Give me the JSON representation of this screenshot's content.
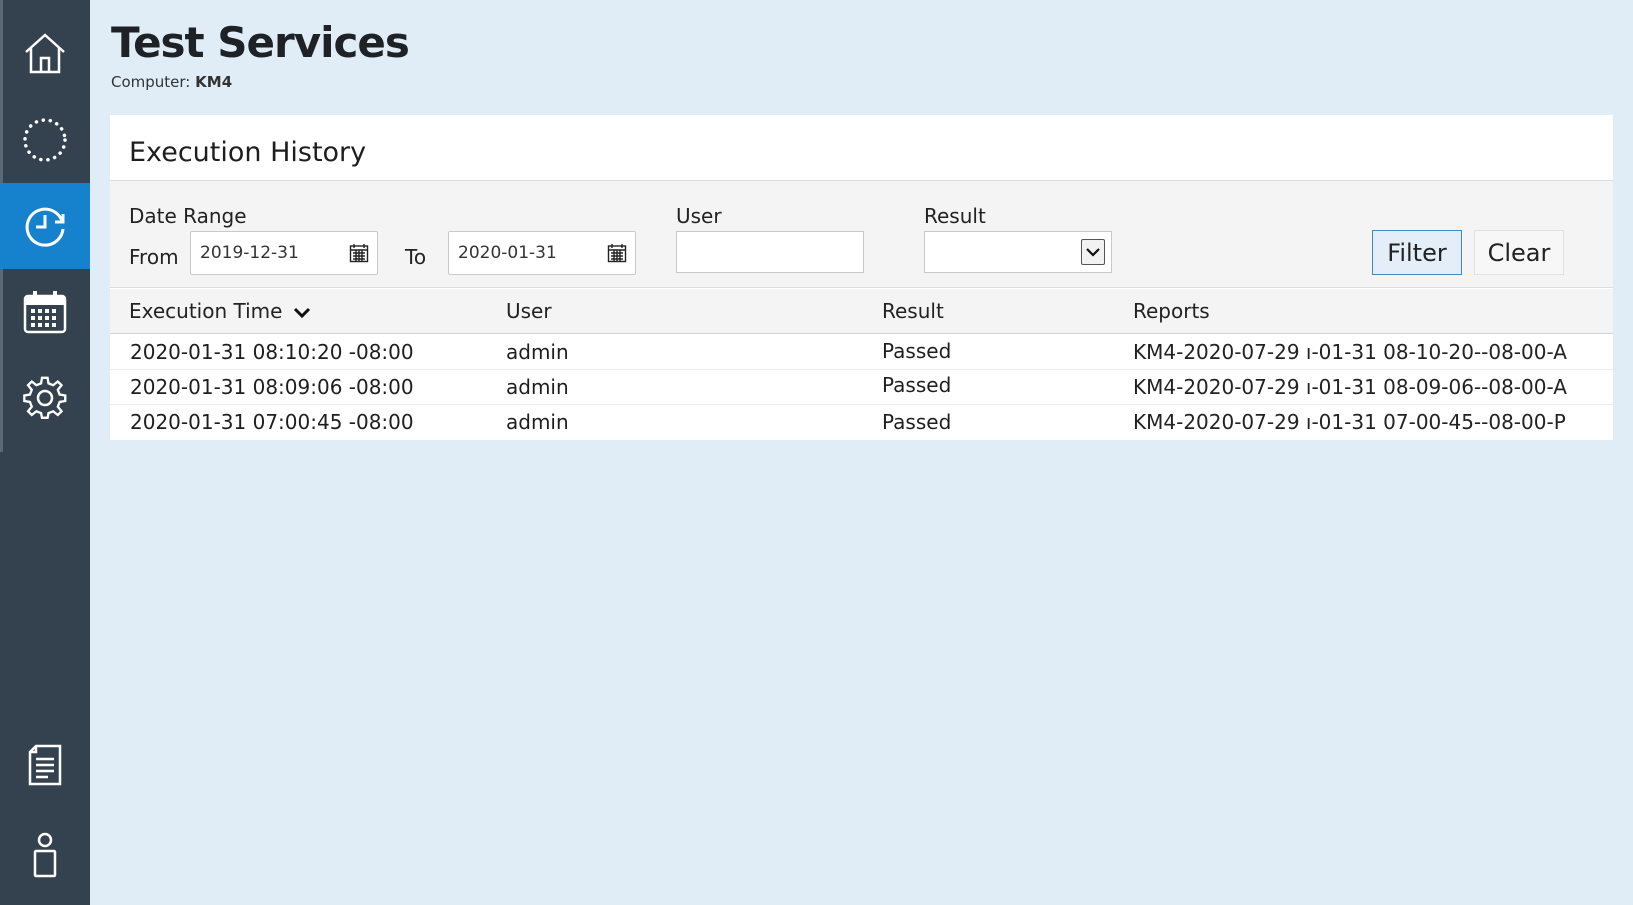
{
  "header": {
    "title": "Test Services",
    "computer_label": "Computer:",
    "computer_value": "KM4"
  },
  "sidebar": {
    "items": [
      {
        "icon": "home-icon"
      },
      {
        "icon": "dotted-circle-icon"
      },
      {
        "icon": "history-clock-icon",
        "active": true
      },
      {
        "icon": "calendar-icon"
      },
      {
        "icon": "gear-icon"
      },
      {
        "icon": "document-icon"
      },
      {
        "icon": "user-icon"
      }
    ]
  },
  "panel": {
    "title": "Execution History"
  },
  "filters": {
    "date_range_label": "Date Range",
    "from_label": "From",
    "from_value": "2019-12-31",
    "to_label": "To",
    "to_value": "2020-01-31",
    "user_label": "User",
    "user_value": "",
    "result_label": "Result",
    "result_value": "",
    "filter_button": "Filter",
    "clear_button": "Clear"
  },
  "table": {
    "columns": [
      "Execution Time",
      "User",
      "Result",
      "Reports"
    ],
    "rows": [
      {
        "time": "2020-01-31 08:10:20 -08:00",
        "user": "admin",
        "result": "Passed",
        "report": "KM4-2020-07-29 ı-01-31 08-10-20--08-00-A"
      },
      {
        "time": "2020-01-31 08:09:06 -08:00",
        "user": "admin",
        "result": "Passed",
        "report": "KM4-2020-07-29 ı-01-31 08-09-06--08-00-A"
      },
      {
        "time": "2020-01-31 07:00:45 -08:00",
        "user": "admin",
        "result": "Passed",
        "report": "KM4-2020-07-29 ı-01-31 07-00-45--08-00-P"
      }
    ]
  },
  "colors": {
    "sidebar_bg": "#344250",
    "active_nav": "#1682cd",
    "page_bg": "#e1edf6",
    "filter_border": "#3d8cc9"
  }
}
